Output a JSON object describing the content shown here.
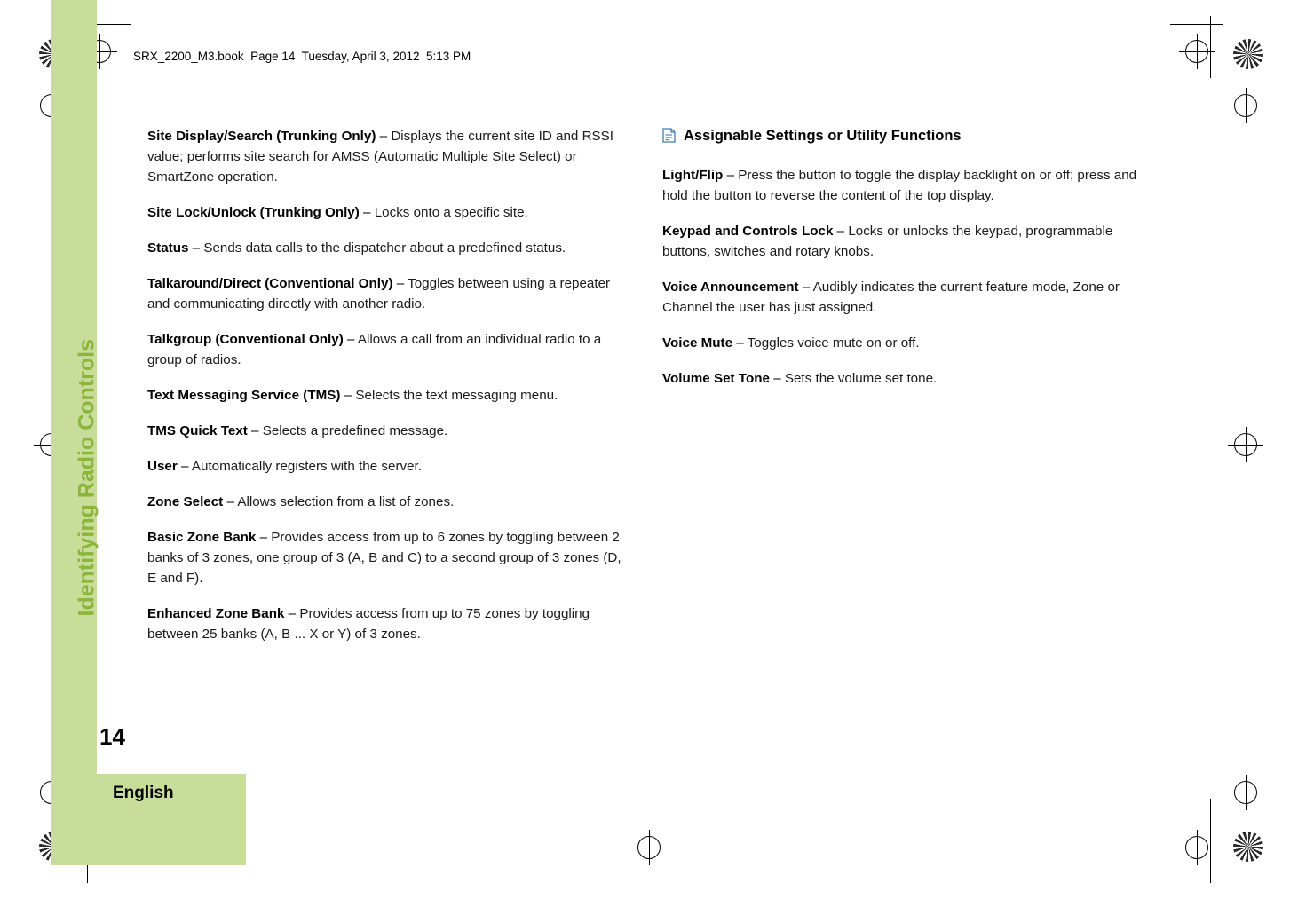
{
  "header": {
    "file_line": "SRX_2200_M3.book  Page 14  Tuesday, April 3, 2012  5:13 PM"
  },
  "side_tab": {
    "chapter_title": "Identifying Radio Controls"
  },
  "footer": {
    "page_number": "14",
    "language": "English"
  },
  "left_column": [
    {
      "term": "Site Display/Search (Trunking Only)",
      "dash": "–",
      "text": " Displays the current site ID and RSSI value; performs site search for AMSS (Automatic Multiple Site Select) or SmartZone operation."
    },
    {
      "term": "Site Lock/Unlock (Trunking Only)",
      "dash": "–",
      "text": " Locks onto a specific site."
    },
    {
      "term": "Status",
      "dash": "–",
      "text": " Sends data calls to the dispatcher about a predefined status."
    },
    {
      "term": "Talkaround/Direct (Conventional Only)",
      "dash": "–",
      "text": " Toggles between using a repeater and communicating directly with another radio."
    },
    {
      "term": "Talkgroup (Conventional Only)",
      "dash": "–",
      "text": " Allows a call from an individual radio to a group of radios."
    },
    {
      "term": "Text Messaging Service (TMS)",
      "dash": "–",
      "text": " Selects the text messaging menu."
    },
    {
      "term": "TMS Quick Text",
      "dash": "–",
      "text": " Selects a predefined message."
    },
    {
      "term": "User",
      "dash": "–",
      "text": " Automatically registers with the server."
    },
    {
      "term": "Zone Select",
      "dash": "–",
      "text": " Allows selection from a list of zones."
    },
    {
      "term": "Basic Zone Bank",
      "dash": "–",
      "text": " Provides access from up to 6 zones by toggling between 2 banks of 3 zones, one group of 3 (A, B and C) to a second group of 3 zones (D, E and F)."
    },
    {
      "term": "Enhanced Zone Bank",
      "dash": "–",
      "text": " Provides access from up to 75 zones by toggling between 25 banks (A, B ... X or Y) of 3 zones."
    }
  ],
  "right_column": {
    "section_heading": "Assignable Settings or Utility Functions",
    "section_icon": "page-icon",
    "paragraphs": [
      {
        "term": "Light/Flip",
        "dash": "–",
        "text": " Press the button to toggle the display backlight on or off; press and hold the button to reverse the content of the top display."
      },
      {
        "term": "Keypad and Controls Lock",
        "dash": "–",
        "text": " Locks or unlocks the keypad, programmable buttons, switches and rotary knobs."
      },
      {
        "term": "Voice Announcement",
        "dash": "–",
        "text": " Audibly indicates the current feature mode, Zone or Channel the user has just assigned."
      },
      {
        "term": "Voice Mute",
        "dash": "–",
        "text": " Toggles voice mute on or off."
      },
      {
        "term": "Volume Set Tone",
        "dash": "–",
        "text": " Sets the volume set tone."
      }
    ]
  },
  "colors": {
    "accent_green": "#8cb53c",
    "band_green": "#c8dd9a",
    "text": "#1a1a1a"
  }
}
